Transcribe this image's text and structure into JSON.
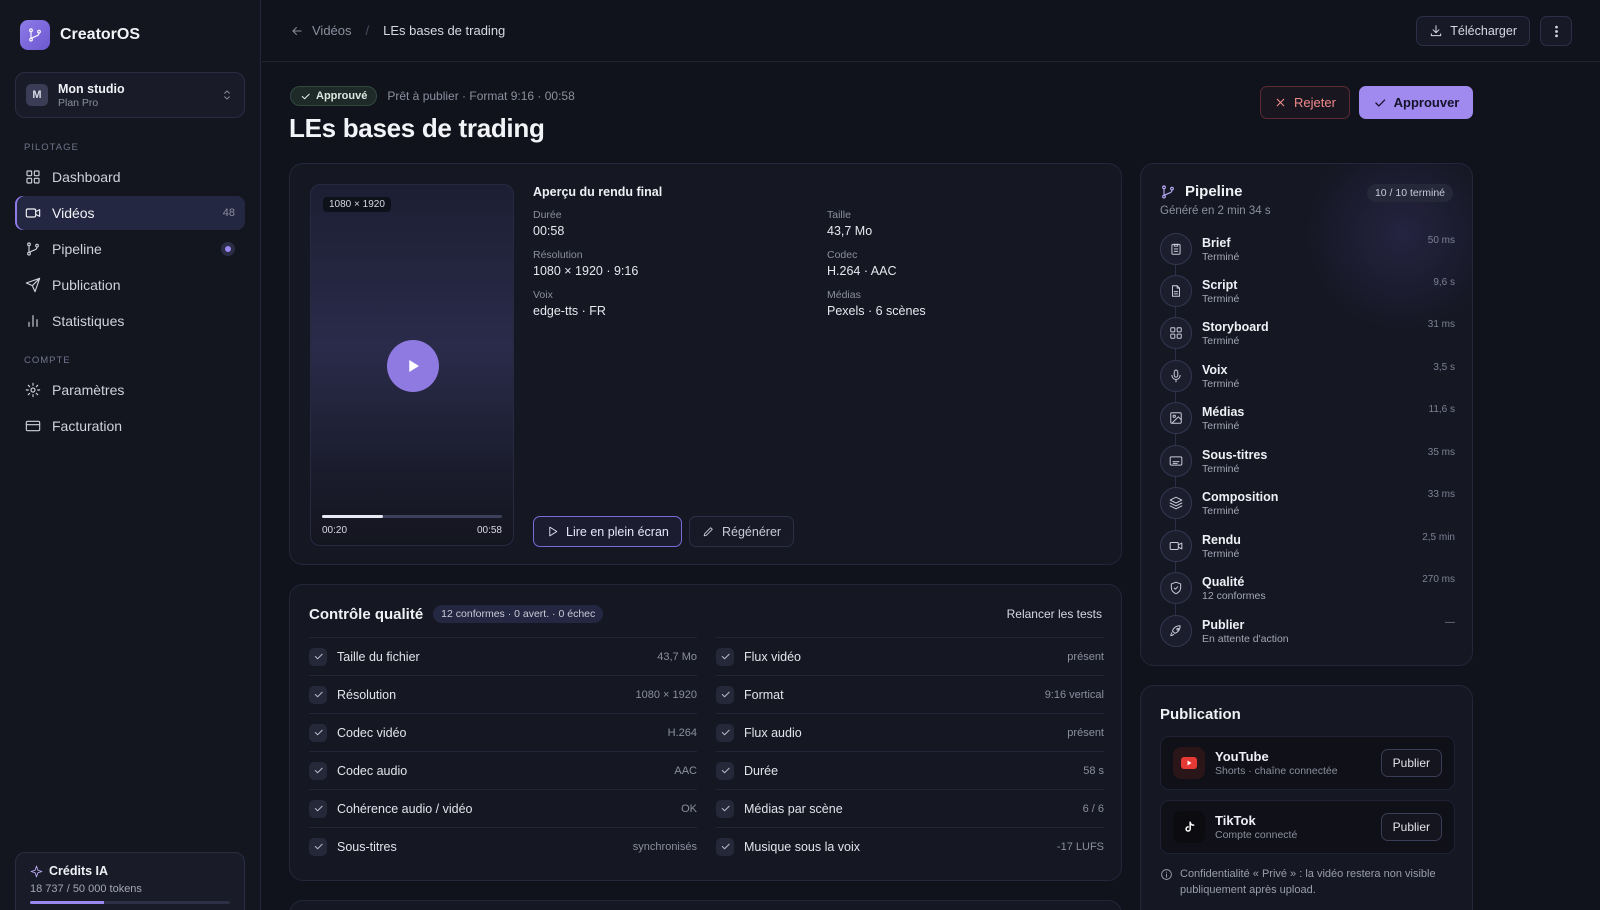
{
  "app": {
    "name": "CreatorOS"
  },
  "studio": {
    "initial": "M",
    "name": "Mon studio",
    "plan": "Plan Pro"
  },
  "sidebar": {
    "section_pilotage": "PILOTAGE",
    "section_compte": "COMPTE",
    "items": [
      {
        "label": "Dashboard",
        "icon": "grid-icon"
      },
      {
        "label": "Vidéos",
        "icon": "video-icon",
        "badge": "48",
        "active": true
      },
      {
        "label": "Pipeline",
        "icon": "branch-icon",
        "status_dot": true
      },
      {
        "label": "Publication",
        "icon": "send-icon"
      },
      {
        "label": "Statistiques",
        "icon": "bar-chart-icon"
      },
      {
        "label": "Paramètres",
        "icon": "gear-icon"
      },
      {
        "label": "Facturation",
        "icon": "credit-card-icon"
      }
    ]
  },
  "credits": {
    "title": "Crédits IA",
    "usage": "18 737 / 50 000 tokens",
    "used_fraction": 0.37
  },
  "topbar": {
    "breadcrumb_parent": "Vidéos",
    "breadcrumb_separator": "/",
    "breadcrumb_current": "LEs bases de trading",
    "download_label": "Télécharger"
  },
  "header": {
    "badge": "Approuvé",
    "status": "Prêt à publier · Format 9:16 · 00:58",
    "title": "LEs bases de trading",
    "reject_label": "Rejeter",
    "approve_label": "Approuver"
  },
  "preview": {
    "resolution_badge": "1080 × 1920",
    "current_time": "00:20",
    "duration": "00:58",
    "progress_fraction": 0.34,
    "title": "Aperçu du rendu final",
    "fields": [
      {
        "label": "Durée",
        "value": "00:58"
      },
      {
        "label": "Taille",
        "value": "43,7 Mo"
      },
      {
        "label": "Résolution",
        "value": "1080 × 1920 · 9:16"
      },
      {
        "label": "Codec",
        "value": "H.264 · AAC"
      },
      {
        "label": "Voix",
        "value": "edge-tts · FR"
      },
      {
        "label": "Médias",
        "value": "Pexels · 6 scènes"
      }
    ],
    "fullscreen_label": "Lire en plein écran",
    "regenerate_label": "Régénérer"
  },
  "quality": {
    "title": "Contrôle qualité",
    "summary": "12 conformes · 0 avert. · 0 échec",
    "rerun_label": "Relancer les tests",
    "left": [
      {
        "name": "Taille du fichier",
        "value": "43,7 Mo"
      },
      {
        "name": "Résolution",
        "value": "1080 × 1920"
      },
      {
        "name": "Codec vidéo",
        "value": "H.264"
      },
      {
        "name": "Codec audio",
        "value": "AAC"
      },
      {
        "name": "Cohérence audio / vidéo",
        "value": "OK"
      },
      {
        "name": "Sous-titres",
        "value": "synchronisés"
      }
    ],
    "right": [
      {
        "name": "Flux vidéo",
        "value": "présent"
      },
      {
        "name": "Format",
        "value": "9:16 vertical"
      },
      {
        "name": "Flux audio",
        "value": "présent"
      },
      {
        "name": "Durée",
        "value": "58 s"
      },
      {
        "name": "Médias par scène",
        "value": "6 / 6"
      },
      {
        "name": "Musique sous la voix",
        "value": "-17 LUFS"
      }
    ]
  },
  "pipeline": {
    "title": "Pipeline",
    "subtitle": "Généré en 2 min 34 s",
    "progress": "10 / 10 terminé",
    "steps": [
      {
        "name": "Brief",
        "state": "Terminé",
        "time": "50 ms",
        "icon": "clipboard-icon"
      },
      {
        "name": "Script",
        "state": "Terminé",
        "time": "9,6 s",
        "icon": "document-icon"
      },
      {
        "name": "Storyboard",
        "state": "Terminé",
        "time": "31 ms",
        "icon": "grid-icon"
      },
      {
        "name": "Voix",
        "state": "Terminé",
        "time": "3,5 s",
        "icon": "microphone-icon"
      },
      {
        "name": "Médias",
        "state": "Terminé",
        "time": "11,6 s",
        "icon": "image-icon"
      },
      {
        "name": "Sous-titres",
        "state": "Terminé",
        "time": "35 ms",
        "icon": "captions-icon"
      },
      {
        "name": "Composition",
        "state": "Terminé",
        "time": "33 ms",
        "icon": "layers-icon"
      },
      {
        "name": "Rendu",
        "state": "Terminé",
        "time": "2,5 min",
        "icon": "video-icon"
      },
      {
        "name": "Qualité",
        "state": "12 conformes",
        "time": "270 ms",
        "icon": "shield-check-icon"
      },
      {
        "name": "Publier",
        "state": "En attente d'action",
        "time": "—",
        "icon": "rocket-icon"
      }
    ]
  },
  "publication": {
    "title": "Publication",
    "platforms": [
      {
        "name": "YouTube",
        "sub": "Shorts · chaîne connectée",
        "button": "Publier",
        "icon": "youtube-icon",
        "color": "#e53935"
      },
      {
        "name": "TikTok",
        "sub": "Compte connecté",
        "button": "Publier",
        "icon": "tiktok-icon",
        "color": "#ffffff"
      }
    ],
    "note": "Confidentialité « Privé » : la vidéo restera non visible publiquement après upload."
  },
  "colors": {
    "accent": "#a08af0",
    "reject": "#f08a8a",
    "background": "#11131c"
  }
}
